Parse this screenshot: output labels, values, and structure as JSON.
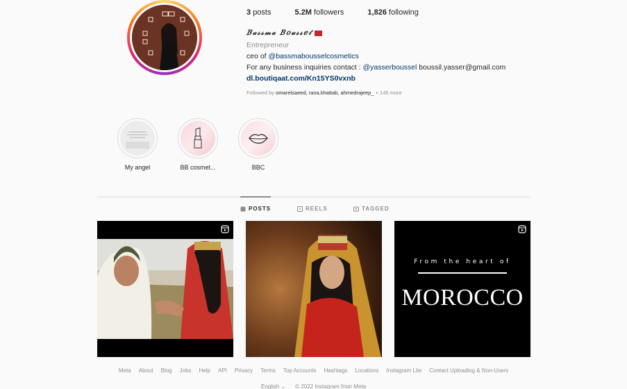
{
  "profile": {
    "posts_count": "3",
    "posts_label": "posts",
    "followers_count": "5.2M",
    "followers_label": "followers",
    "following_count": "1,826",
    "following_label": "following",
    "display_name": "𝐵𝒶𝓈𝓈𝓂𝒶 𝐵𝑜𝓊𝓈𝓈𝑒𝓉",
    "category": "Entrepreneur",
    "bio_line1_prefix": "ceo of",
    "bio_line1_mention": "@bassmabousselcosmetics",
    "bio_line2_prefix": "For any business inquiries contact :",
    "bio_line2_mention": "@yasserboussel",
    "bio_line2_email": "boussil.yasser@gmail.com",
    "link": "dl.boutiqaat.com/Kn15YS0vxnb",
    "followed_by_prefix": "Followed by",
    "followed_by_users": "omarelsaeed, rana.khattab, ahmedrajeep_",
    "followed_by_more": "+ 145 more"
  },
  "highlights": [
    {
      "label": "My angel"
    },
    {
      "label": "BB cosmet..."
    },
    {
      "label": "BBC"
    }
  ],
  "tabs": [
    {
      "label": "POSTS",
      "icon": "grid-icon",
      "active": true
    },
    {
      "label": "REELS",
      "icon": "reels-icon",
      "active": false
    },
    {
      "label": "TAGGED",
      "icon": "tagged-icon",
      "active": false
    }
  ],
  "posts": [
    {
      "type": "reel"
    },
    {
      "type": "image"
    },
    {
      "type": "reel",
      "text_line1": "From the heart of",
      "text_line2": "MOROCCO"
    }
  ],
  "footer": {
    "links": [
      "Meta",
      "About",
      "Blog",
      "Jobs",
      "Help",
      "API",
      "Privacy",
      "Terms",
      "Top Accounts",
      "Hashtags",
      "Locations",
      "Instagram Lite",
      "Contact Uploading & Non-Users"
    ],
    "language": "English",
    "copyright": "© 2022 Instagram from Meta"
  },
  "colors": {
    "link": "#00376b",
    "muted": "#8e8e8e",
    "flag": "#c1272d",
    "avatar_bg": "#6b3324"
  }
}
